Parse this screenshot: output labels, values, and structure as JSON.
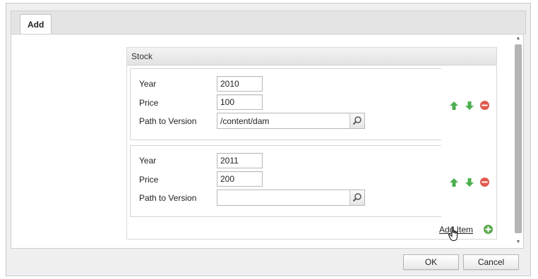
{
  "dialog": {
    "tab_label": "Add",
    "ok_label": "OK",
    "cancel_label": "Cancel"
  },
  "stock": {
    "title": "Stock",
    "labels": {
      "year": "Year",
      "price": "Price",
      "path": "Path to Version"
    },
    "items": [
      {
        "year": "2010",
        "price": "100",
        "path": "/content/dam"
      },
      {
        "year": "2011",
        "price": "200",
        "path": ""
      }
    ],
    "add_item_label": "Add Item"
  },
  "icons": {
    "move_up": "arrow-up-icon",
    "move_down": "arrow-down-icon",
    "remove": "remove-icon",
    "search": "search-icon",
    "add": "add-icon",
    "cursor": "hand-cursor-icon"
  },
  "colors": {
    "green_arrow": "#4caf50",
    "remove_red": "#e05a4e",
    "add_green": "#5aa84a"
  }
}
